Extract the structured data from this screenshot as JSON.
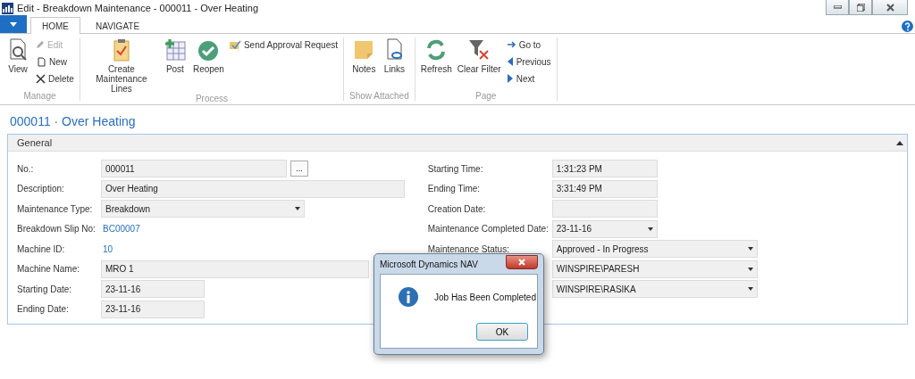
{
  "window": {
    "title": "Edit - Breakdown Maintenance - 000011 - Over Heating"
  },
  "tabs": [
    {
      "label": "HOME",
      "selected": true
    },
    {
      "label": "NAVIGATE",
      "selected": false
    }
  ],
  "ribbon_groups": [
    {
      "label": "Manage",
      "items": [
        {
          "kind": "large",
          "label": "View",
          "disabled": false
        },
        {
          "kind": "small",
          "label": "Edit",
          "disabled": true
        },
        {
          "kind": "small",
          "label": "New",
          "disabled": false
        },
        {
          "kind": "small",
          "label": "Delete",
          "disabled": false
        }
      ]
    },
    {
      "label": "Process",
      "items": [
        {
          "kind": "large",
          "label": "Create Maintenance Lines",
          "disabled": false
        },
        {
          "kind": "large",
          "label": "Post",
          "disabled": false
        },
        {
          "kind": "large",
          "label": "Reopen",
          "disabled": false
        },
        {
          "kind": "small",
          "label": "Send Approval Request",
          "disabled": false
        }
      ]
    },
    {
      "label": "Show Attached",
      "items": [
        {
          "kind": "large",
          "label": "Notes",
          "disabled": false
        },
        {
          "kind": "large",
          "label": "Links",
          "disabled": false
        }
      ]
    },
    {
      "label": "Page",
      "items": [
        {
          "kind": "large",
          "label": "Refresh",
          "disabled": false
        },
        {
          "kind": "large",
          "label": "Clear Filter",
          "disabled": false
        },
        {
          "kind": "small",
          "label": "Go to",
          "disabled": false
        },
        {
          "kind": "small",
          "label": "Previous",
          "disabled": false
        },
        {
          "kind": "small",
          "label": "Next",
          "disabled": false
        }
      ]
    }
  ],
  "page_title": "000011 · Over Heating",
  "section": {
    "title": "General",
    "expanded": true
  },
  "left_fields": [
    {
      "label": "No.:",
      "kind": "input",
      "value": "000011",
      "assist": "..."
    },
    {
      "label": "Description:",
      "kind": "input",
      "value": "Over Heating"
    },
    {
      "label": "Maintenance Type:",
      "kind": "dropdown",
      "value": "Breakdown"
    },
    {
      "label": "Breakdown Slip No:",
      "kind": "link",
      "value": "BC00007"
    },
    {
      "label": "Machine ID:",
      "kind": "link",
      "value": "10"
    },
    {
      "label": "Machine Name:",
      "kind": "input",
      "value": "MRO 1"
    },
    {
      "label": "Starting Date:",
      "kind": "input",
      "value": "23-11-16"
    },
    {
      "label": "Ending Date:",
      "kind": "input",
      "value": "23-11-16"
    }
  ],
  "right_fields": [
    {
      "label": "Starting Time:",
      "kind": "input",
      "value": "1:31:23 PM"
    },
    {
      "label": "Ending Time:",
      "kind": "input",
      "value": "3:31:49 PM"
    },
    {
      "label": "Creation Date:",
      "kind": "input"
    },
    {
      "label": "Maintenance Completed Date:",
      "kind": "dropdown",
      "value": "23-11-16"
    },
    {
      "label": "Maintenance Status:",
      "kind": "dropdown",
      "value": "Approved - In Progress"
    },
    {
      "kind": "dropdown",
      "value": "WINSPIRE\\PARESH"
    },
    {
      "kind": "dropdown",
      "value": "WINSPIRE\\RASIKA"
    }
  ],
  "dialog": {
    "title": "Microsoft Dynamics NAV",
    "message": "Job Has Been Completed",
    "button": "OK"
  }
}
